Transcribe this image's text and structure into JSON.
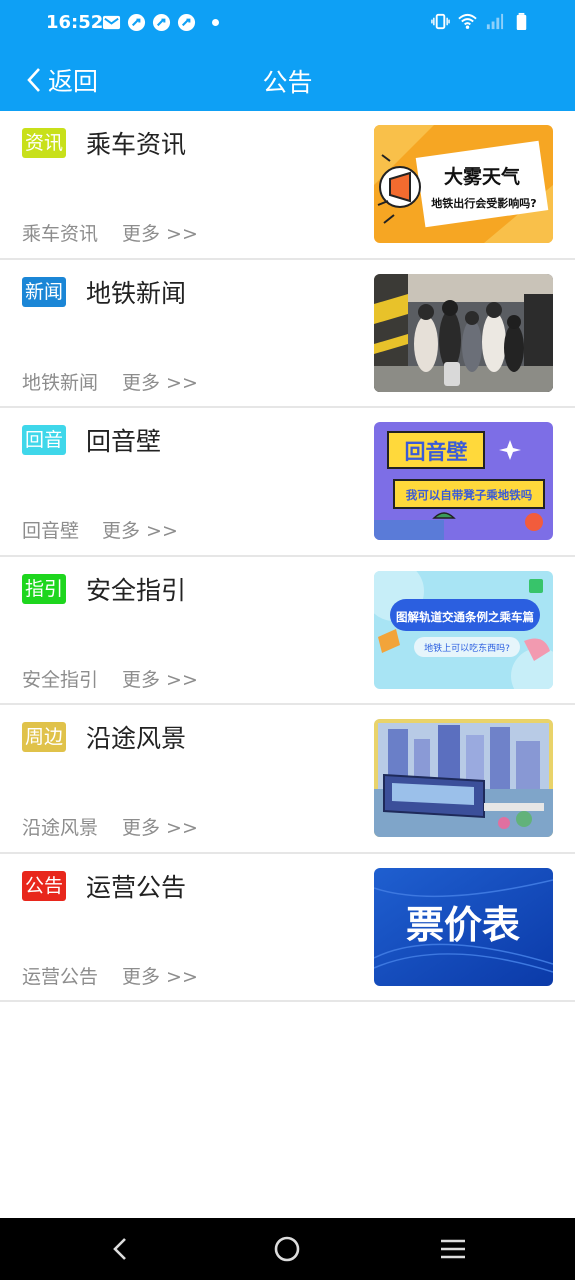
{
  "status_bar": {
    "time": "16:52",
    "icons": [
      "mail-icon",
      "app-icon",
      "app-icon",
      "app-icon",
      "dot",
      "vibrate-icon",
      "wifi-icon",
      "signal-icon",
      "battery-icon"
    ]
  },
  "header": {
    "back_label": "返回",
    "title": "公告"
  },
  "rows": [
    {
      "tag": "资讯",
      "tag_color": "#c8e01a",
      "title": "乘车资讯",
      "subtitle": "乘车资讯",
      "more": "更多 >>",
      "thumb": {
        "headline": "大雾天气",
        "caption": "地铁出行会受影响吗?"
      }
    },
    {
      "tag": "新闻",
      "tag_color": "#1b86d6",
      "title": "地铁新闻",
      "subtitle": "地铁新闻",
      "more": "更多 >>",
      "thumb": {}
    },
    {
      "tag": "回音",
      "tag_color": "#3fd7ea",
      "title": "回音壁",
      "subtitle": "回音壁",
      "more": "更多 >>",
      "thumb": {
        "headline": "回音壁",
        "caption": "我可以自带凳子乘地铁吗"
      }
    },
    {
      "tag": "指引",
      "tag_color": "#1ed61e",
      "title": "安全指引",
      "subtitle": "安全指引",
      "more": "更多 >>",
      "thumb": {
        "headline": "图解轨道交通条例之乘车篇",
        "caption": "地铁上可以吃东西吗?"
      }
    },
    {
      "tag": "周边",
      "tag_color": "#e0c24a",
      "title": "沿途风景",
      "subtitle": "沿途风景",
      "more": "更多 >>",
      "thumb": {}
    },
    {
      "tag": "公告",
      "tag_color": "#e8271c",
      "title": "运营公告",
      "subtitle": "运营公告",
      "more": "更多 >>",
      "thumb": {
        "headline": "票价表"
      }
    }
  ],
  "nav_bar": {
    "buttons": [
      "back-nav-icon",
      "home-nav-icon",
      "menu-nav-icon"
    ]
  },
  "colors": {
    "primary": "#0ea0f5",
    "divider": "#e6e6e6",
    "muted_text": "#8d8d8d"
  }
}
